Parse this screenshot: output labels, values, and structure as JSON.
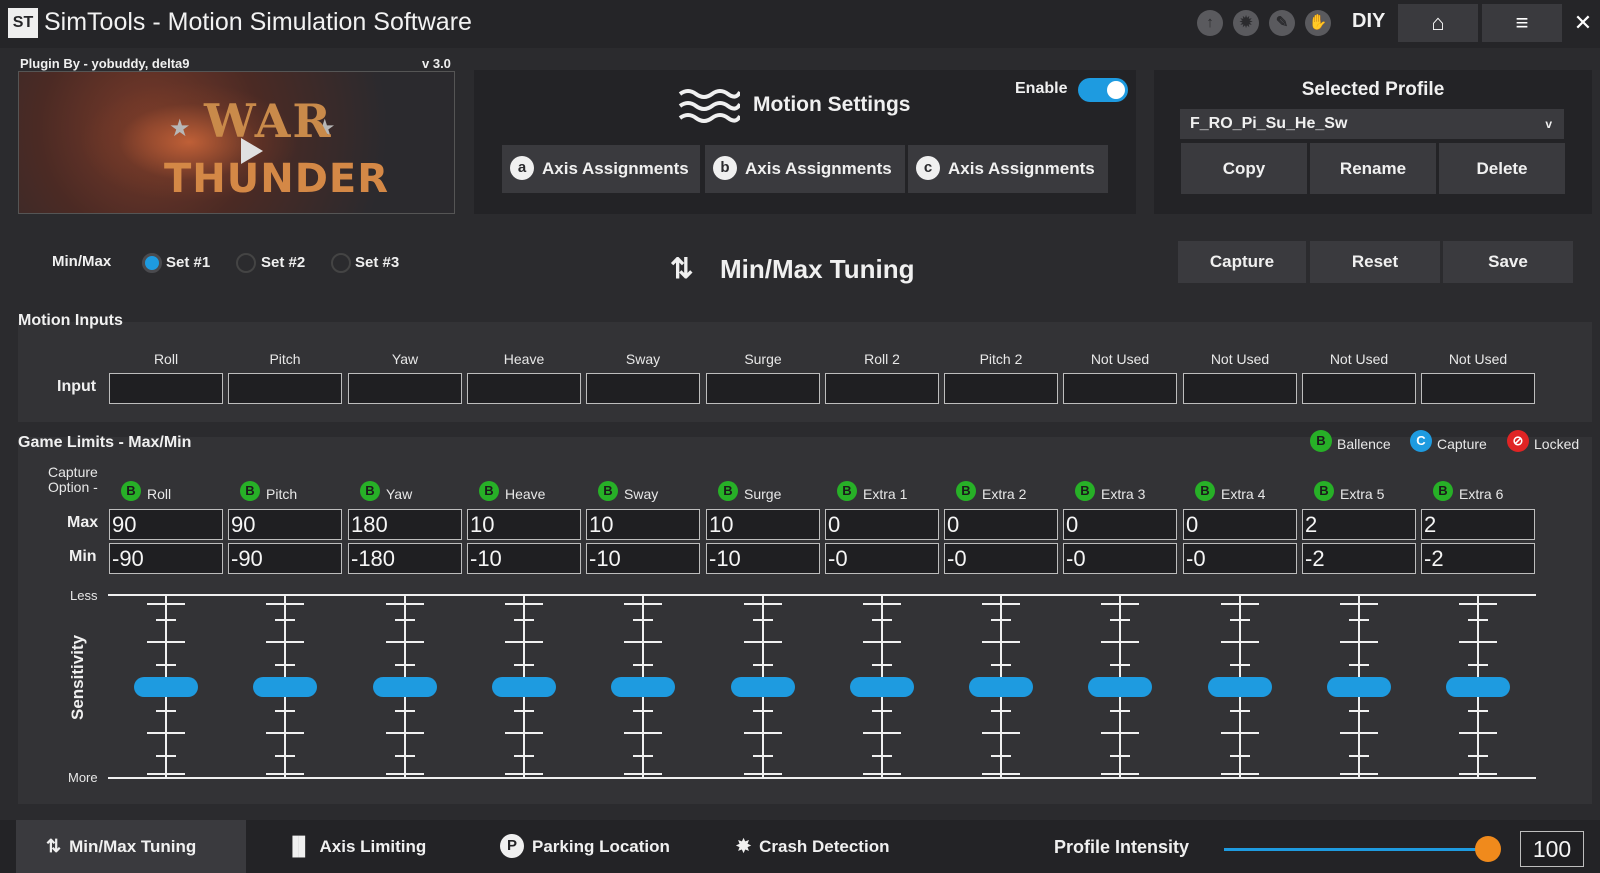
{
  "app": {
    "logo": "ST",
    "title": "SimTools - Motion Simulation Software",
    "top_icons": [
      "up-arrow-icon",
      "settings-burst-icon",
      "pencil-icon",
      "glove-icon"
    ],
    "diy": "DIY",
    "home_glyph": "⌂",
    "menu_glyph": "≡",
    "close_glyph": "✕"
  },
  "plugin": {
    "by": "Plugin By - yobuddy, delta9",
    "version": "v 3.0",
    "logo_text_1": "WAR",
    "logo_text_2": "THUNDER"
  },
  "motion_settings": {
    "title": "Motion Settings",
    "enable_label": "Enable",
    "enabled": true,
    "axis_buttons": [
      {
        "letter": "a",
        "label": "Axis Assignments"
      },
      {
        "letter": "b",
        "label": "Axis Assignments"
      },
      {
        "letter": "c",
        "label": "Axis Assignments"
      }
    ]
  },
  "profile": {
    "title": "Selected Profile",
    "selected": "F_RO_Pi_Su_He_Sw",
    "chevron": "v",
    "buttons": [
      "Copy",
      "Rename",
      "Delete"
    ]
  },
  "minmax": {
    "label": "Min/Max",
    "sets": [
      "Set #1",
      "Set #2",
      "Set #3"
    ],
    "selected_set": 0,
    "title": "Min/Max Tuning",
    "title_icon": "⇅",
    "actions": [
      "Capture",
      "Reset",
      "Save"
    ]
  },
  "motion_inputs": {
    "title": "Motion Inputs",
    "row_label": "Input",
    "columns": [
      "Roll",
      "Pitch",
      "Yaw",
      "Heave",
      "Sway",
      "Surge",
      "Roll 2",
      "Pitch 2",
      "Not Used",
      "Not Used",
      "Not Used",
      "Not Used"
    ]
  },
  "game_limits": {
    "title": "Game Limits - Max/Min",
    "legend": [
      {
        "letter": "B",
        "label": "Ballence",
        "color": "#27b027"
      },
      {
        "letter": "C",
        "label": "Capture",
        "color": "#1e9be0"
      },
      {
        "letter": "⊘",
        "label": "Locked",
        "color": "#e02424"
      }
    ],
    "capture_option": "Capture Option -",
    "option_letter": "B",
    "columns": [
      "Roll",
      "Pitch",
      "Yaw",
      "Heave",
      "Sway",
      "Surge",
      "Extra 1",
      "Extra 2",
      "Extra 3",
      "Extra 4",
      "Extra 5",
      "Extra 6"
    ],
    "max_label": "Max",
    "min_label": "Min",
    "max": [
      "90",
      "90",
      "180",
      "10",
      "10",
      "10",
      "0",
      "0",
      "0",
      "0",
      "2",
      "2"
    ],
    "min": [
      "-90",
      "-90",
      "-180",
      "-10",
      "-10",
      "-10",
      "-0",
      "-0",
      "-0",
      "-0",
      "-2",
      "-2"
    ],
    "sensitivity_label": "Sensitivity",
    "less_label": "Less",
    "more_label": "More",
    "sensitivity_levels": [
      0.5,
      0.5,
      0.5,
      0.5,
      0.5,
      0.5,
      0.5,
      0.5,
      0.5,
      0.5,
      0.5,
      0.5
    ]
  },
  "bottom_tabs": [
    {
      "icon": "⇅",
      "label": "Min/Max Tuning",
      "active": true
    },
    {
      "icon": "▐▌",
      "label": "Axis Limiting",
      "active": false
    },
    {
      "icon": "P",
      "label": "Parking Location",
      "active": false
    },
    {
      "icon": "✸",
      "label": "Crash Detection",
      "active": false
    }
  ],
  "intensity": {
    "label": "Profile Intensity",
    "value": "100",
    "level": 1.0
  }
}
